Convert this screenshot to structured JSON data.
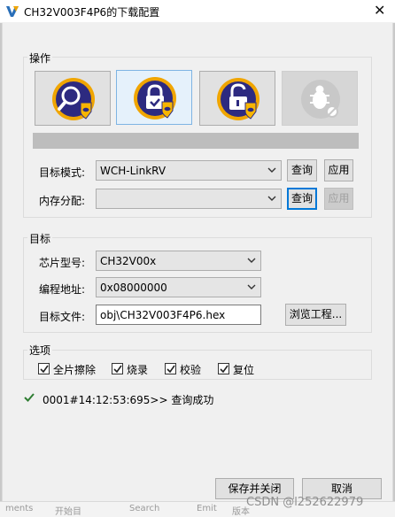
{
  "window": {
    "title": "CH32V003F4P6的下载配置",
    "close_glyph": "✕"
  },
  "operation": {
    "legend": "操作",
    "tools": [
      {
        "icon": "search-chip-icon",
        "selected": false,
        "disabled": false
      },
      {
        "icon": "lock-chip-icon",
        "selected": true,
        "disabled": false
      },
      {
        "icon": "unlock-chip-icon",
        "selected": false,
        "disabled": false
      },
      {
        "icon": "debug-bug-icon",
        "selected": false,
        "disabled": true
      }
    ],
    "progress_fraction": 0.0,
    "target_mode": {
      "label": "目标模式:",
      "value": "WCH-LinkRV",
      "query_label": "查询",
      "apply_label": "应用"
    },
    "memory_alloc": {
      "label": "内存分配:",
      "value": "",
      "query_label": "查询",
      "apply_label": "应用"
    }
  },
  "target": {
    "legend": "目标",
    "chip_model": {
      "label": "芯片型号:",
      "value": "CH32V00x"
    },
    "program_address": {
      "label": "编程地址:",
      "value": "0x08000000"
    },
    "target_file": {
      "label": "目标文件:",
      "value": "obj\\CH32V003F4P6.hex"
    },
    "browse_label": "浏览工程..."
  },
  "options": {
    "legend": "选项",
    "items": [
      {
        "label": "全片擦除",
        "checked": true
      },
      {
        "label": "烧录",
        "checked": true
      },
      {
        "label": "校验",
        "checked": true
      },
      {
        "label": "复位",
        "checked": true
      }
    ]
  },
  "status": {
    "message": "0001#14:12:53:695>> 查询成功",
    "color": "#2e7d32"
  },
  "footer": {
    "save_close_label": "保存并关闭",
    "cancel_label": "取消"
  },
  "background": {
    "taskbar_items": [
      "ments",
      "开始目",
      "Search",
      "Emit",
      "版本"
    ],
    "watermark": "CSDN @l252622979"
  },
  "colors": {
    "accent": "#0078d7",
    "icon_ring": "#f0a500",
    "icon_core": "#2d2a80",
    "shield": "#f7b500"
  }
}
